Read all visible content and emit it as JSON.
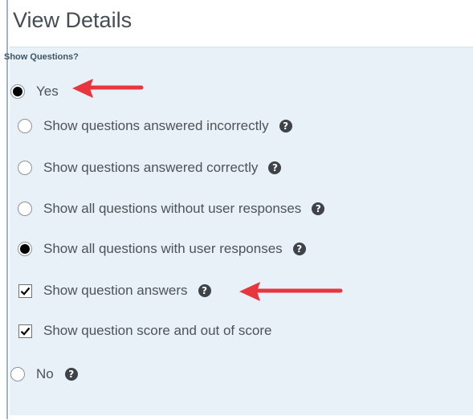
{
  "header": {
    "title": "View Details"
  },
  "section": {
    "label": "Show Questions?"
  },
  "options": {
    "yes": {
      "label": "Yes",
      "selected": true
    },
    "answered_incorrectly": {
      "label": "Show questions answered incorrectly",
      "selected": false,
      "help_icon": "question-circle-icon"
    },
    "answered_correctly": {
      "label": "Show questions answered correctly",
      "selected": false,
      "help_icon": "question-circle-icon"
    },
    "without_responses": {
      "label": "Show all questions without user responses",
      "selected": false,
      "help_icon": "question-circle-icon"
    },
    "with_responses": {
      "label": "Show all questions with user responses",
      "selected": true,
      "help_icon": "question-circle-icon"
    },
    "show_answers": {
      "label": "Show question answers",
      "checked": true,
      "help_icon": "question-circle-icon"
    },
    "show_score": {
      "label": "Show question score and out of score",
      "checked": true
    },
    "no": {
      "label": "No",
      "selected": false,
      "help_icon": "question-circle-icon"
    }
  },
  "annotations": {
    "arrow_color": "#e8363f"
  }
}
